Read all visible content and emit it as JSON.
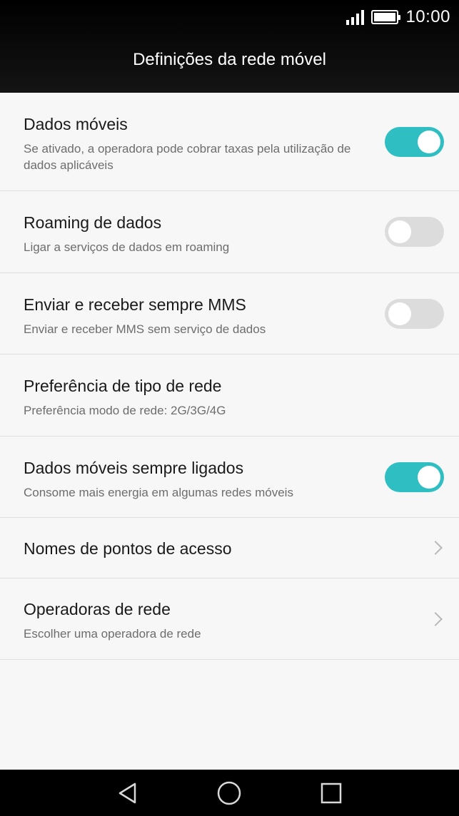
{
  "status_bar": {
    "time": "10:00",
    "signal_icon": "signal-icon",
    "battery_icon": "battery-icon"
  },
  "header": {
    "title": "Definições da rede móvel"
  },
  "settings": [
    {
      "title": "Dados móveis",
      "subtitle": "Se ativado, a operadora pode cobrar taxas pela utilização de dados aplicáveis",
      "control": "toggle",
      "enabled": true
    },
    {
      "title": "Roaming de dados",
      "subtitle": "Ligar a serviços de dados em roaming",
      "control": "toggle",
      "enabled": false
    },
    {
      "title": "Enviar e receber sempre MMS",
      "subtitle": "Enviar e receber MMS sem serviço de dados",
      "control": "toggle",
      "enabled": false
    },
    {
      "title": "Preferência de tipo de rede",
      "subtitle": "Preferência modo de rede: 2G/3G/4G",
      "control": "none"
    },
    {
      "title": "Dados móveis sempre ligados",
      "subtitle": "Consome mais energia em algumas redes móveis",
      "control": "toggle",
      "enabled": true
    },
    {
      "title": "Nomes de pontos de acesso",
      "subtitle": "",
      "control": "chevron"
    },
    {
      "title": "Operadoras de rede",
      "subtitle": "Escolher uma operadora de rede",
      "control": "chevron"
    }
  ],
  "nav_bar": {
    "back_icon": "back-icon",
    "home_icon": "home-icon",
    "recents_icon": "recents-icon"
  },
  "colors": {
    "header_background": "#000000",
    "toggle_on": "#2fbfc2",
    "toggle_off": "#dcdcdc",
    "page_background": "#f7f7f7"
  }
}
